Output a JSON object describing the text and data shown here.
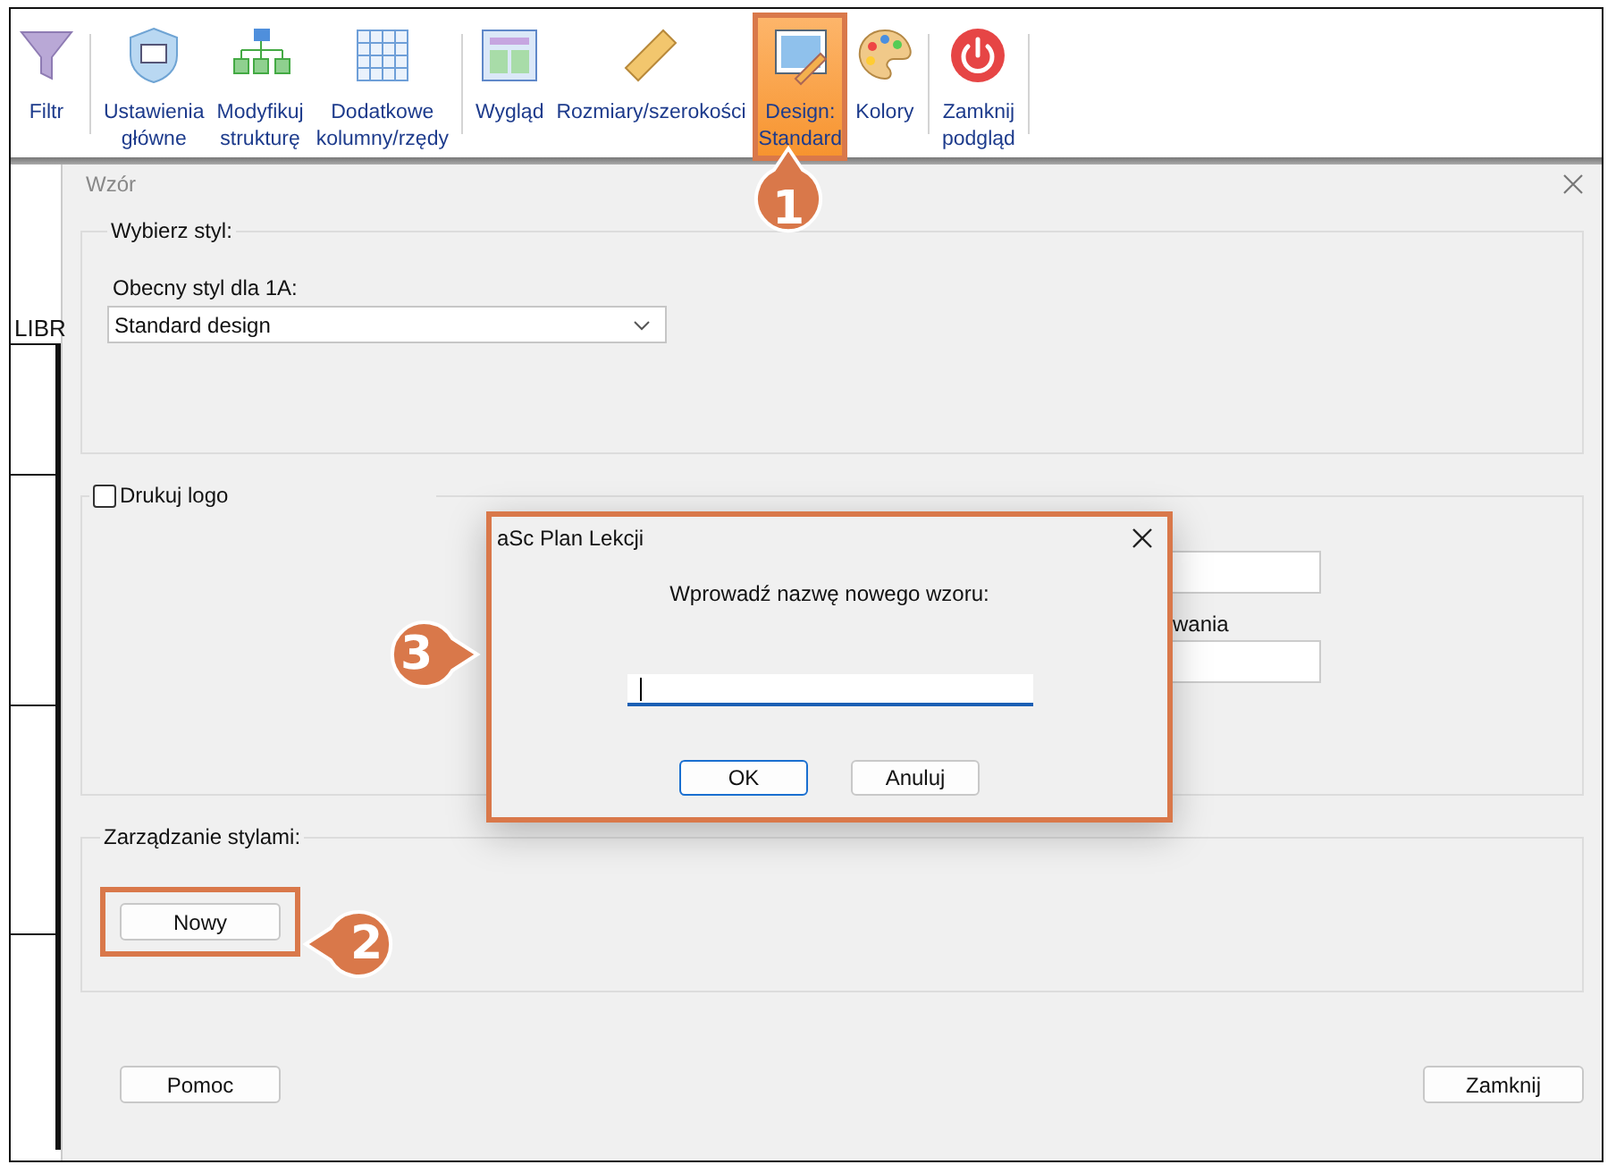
{
  "toolbar": {
    "groups": [
      [
        {
          "lines": [
            "Filtr"
          ],
          "selected": false
        }
      ],
      [
        {
          "lines": [
            "Ustawienia",
            "główne"
          ],
          "selected": false
        },
        {
          "lines": [
            "Modyfikuj",
            "strukturę"
          ],
          "selected": false
        },
        {
          "lines": [
            "Dodatkowe",
            "kolumny/rzędy"
          ],
          "selected": false
        }
      ],
      [
        {
          "lines": [
            "Wygląd"
          ],
          "selected": false
        },
        {
          "lines": [
            "Rozmiary/szerokości"
          ],
          "selected": false
        },
        {
          "lines": [
            "Design:",
            "Standard"
          ],
          "selected": true
        },
        {
          "lines": [
            "Kolory"
          ],
          "selected": false
        }
      ],
      [
        {
          "lines": [
            "Zamknij",
            "podgląd"
          ],
          "selected": false
        }
      ]
    ]
  },
  "background": {
    "header_text": "LIBR"
  },
  "dialog": {
    "title": "Wzór",
    "style_group": {
      "legend": "Wybierz styl:",
      "label": "Obecny styl dla 1A:",
      "select_value": "Standard design"
    },
    "logo_group": {
      "checkbox": {
        "label": "Drukuj logo",
        "checked": false
      },
      "label_fragment": "wania"
    },
    "manage_group": {
      "legend": "Zarządzanie stylami:",
      "button": "Nowy"
    },
    "buttons": [
      "Pomoc",
      "Zamknij"
    ]
  },
  "prompt": {
    "title": "aSc Plan Lekcji",
    "message": "Wprowadź nazwę nowego wzoru:",
    "buttons": [
      {
        "label": "OK",
        "default": true
      },
      {
        "label": "Anuluj",
        "default": false
      }
    ]
  },
  "callouts": [
    {
      "label": "1"
    },
    {
      "label": "2"
    },
    {
      "label": "3"
    }
  ]
}
